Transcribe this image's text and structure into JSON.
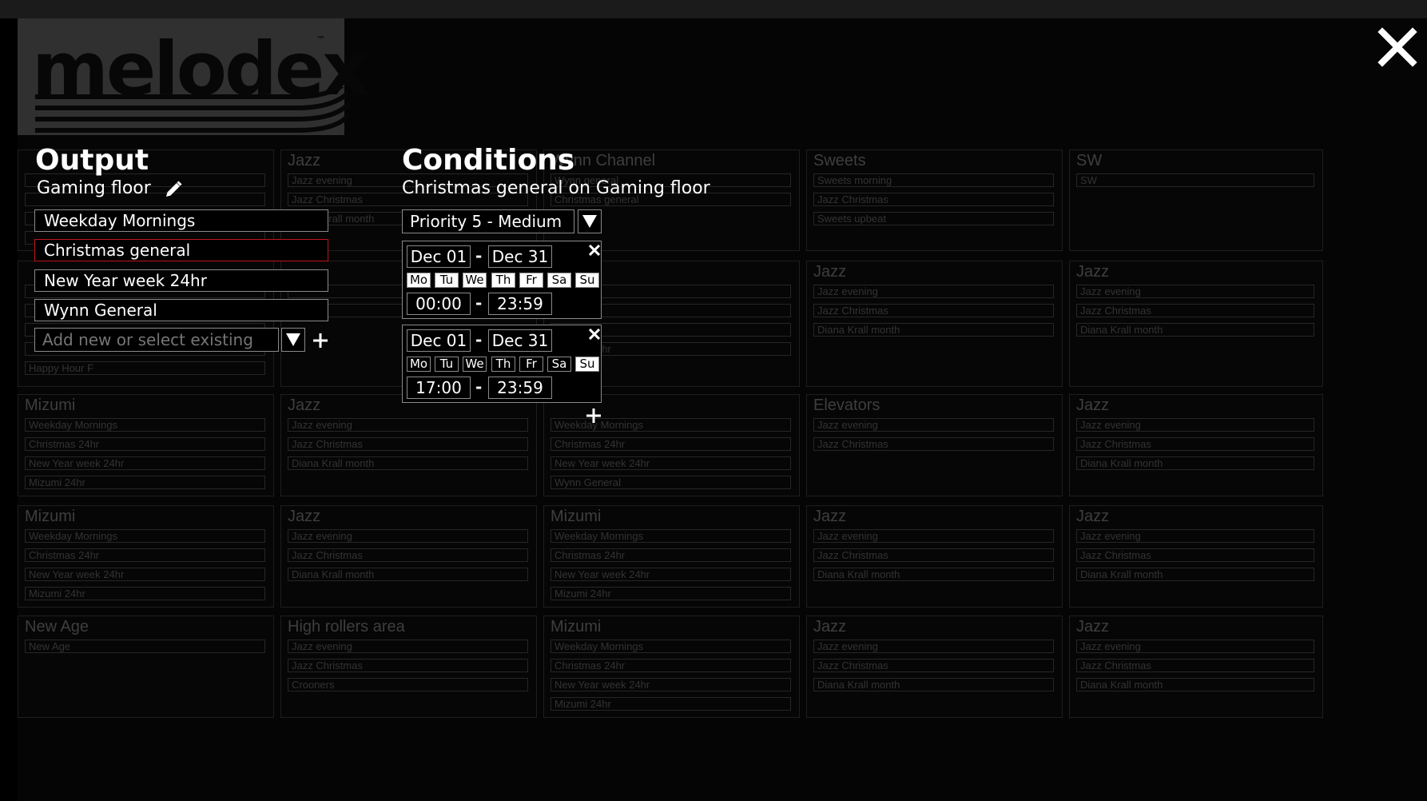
{
  "app": {
    "logo_text": "melodex",
    "logo_tm": "™",
    "close_icon": "close-icon"
  },
  "grid": [
    {
      "title": "",
      "items": [
        "",
        "",
        "",
        ""
      ]
    },
    {
      "title": "Jazz",
      "items": [
        "Jazz evening",
        "Jazz Christmas",
        "Diana Krall month"
      ]
    },
    {
      "title": "Wynn Channel",
      "items": [
        "Wynn general",
        "Christmas general"
      ]
    },
    {
      "title": "Sweets",
      "items": [
        "Sweets morning",
        "Jazz Christmas",
        "Sweets upbeat"
      ]
    },
    {
      "title": "SW",
      "items": [
        "SW"
      ]
    },
    {
      "title": "",
      "items": [
        "",
        "",
        "",
        "",
        "Happy Hour F"
      ]
    },
    {
      "title": "",
      "items": [
        "",
        ""
      ]
    },
    {
      "title": "",
      "items": [
        "",
        "",
        "",
        "Mizumi 24hr"
      ]
    },
    {
      "title": "Jazz",
      "items": [
        "Jazz evening",
        "Jazz Christmas",
        "Diana Krall month"
      ]
    },
    {
      "title": "Jazz",
      "items": [
        "Jazz evening",
        "Jazz Christmas",
        "Diana Krall month"
      ]
    },
    {
      "title": "Mizumi",
      "items": [
        "Weekday Mornings",
        "Christmas 24hr",
        "New Year week 24hr",
        "Mizumi 24hr"
      ]
    },
    {
      "title": "Jazz",
      "items": [
        "Jazz evening",
        "Jazz Christmas",
        "Diana Krall month"
      ]
    },
    {
      "title": "",
      "items": [
        "Weekday Mornings",
        "Christmas 24hr",
        "New Year week 24hr",
        "Wynn General"
      ]
    },
    {
      "title": "Elevators",
      "items": [
        "Jazz evening",
        "Jazz Christmas"
      ]
    },
    {
      "title": "Jazz",
      "items": [
        "Jazz evening",
        "Jazz Christmas",
        "Diana Krall month"
      ]
    },
    {
      "title": "Mizumi",
      "items": [
        "Weekday Mornings",
        "Christmas 24hr",
        "New Year week 24hr",
        "Mizumi 24hr"
      ]
    },
    {
      "title": "Jazz",
      "items": [
        "Jazz evening",
        "Jazz Christmas",
        "Diana Krall month"
      ]
    },
    {
      "title": "Mizumi",
      "items": [
        "Weekday Mornings",
        "Christmas 24hr",
        "New Year week 24hr",
        "Mizumi 24hr"
      ]
    },
    {
      "title": "Jazz",
      "items": [
        "Jazz evening",
        "Jazz Christmas",
        "Diana Krall month"
      ]
    },
    {
      "title": "Jazz",
      "items": [
        "Jazz evening",
        "Jazz Christmas",
        "Diana Krall month"
      ]
    },
    {
      "title": "New Age",
      "items": [
        "New Age"
      ]
    },
    {
      "title": "High rollers area",
      "items": [
        "Jazz evening",
        "Jazz Christmas",
        "Crooners"
      ]
    },
    {
      "title": "Mizumi",
      "items": [
        "Weekday Mornings",
        "Christmas 24hr",
        "New Year week 24hr",
        "Mizumi 24hr"
      ]
    },
    {
      "title": "Jazz",
      "items": [
        "Jazz evening",
        "Jazz Christmas",
        "Diana Krall month"
      ]
    },
    {
      "title": "Jazz",
      "items": [
        "Jazz evening",
        "Jazz Christmas",
        "Diana Krall month"
      ]
    }
  ],
  "output": {
    "heading": "Output",
    "name": "Gaming floor",
    "edit_icon": "pencil-icon",
    "items": [
      "Weekday Mornings",
      "Christmas general",
      "New Year week 24hr",
      "Wynn General"
    ],
    "selected_index": 1,
    "add_placeholder": "Add new or select existing"
  },
  "conditions": {
    "heading": "Conditions",
    "subtitle": "Christmas general on Gaming floor",
    "priority": "Priority 5 - Medium",
    "days": [
      "Mo",
      "Tu",
      "We",
      "Th",
      "Fr",
      "Sa",
      "Su"
    ],
    "blocks": [
      {
        "date_from": "Dec 01",
        "date_to": "Dec 31",
        "time_from": "00:00",
        "time_to": "23:59",
        "active_days": [
          0,
          1,
          2,
          3,
          4,
          5,
          6
        ]
      },
      {
        "date_from": "Dec 01",
        "date_to": "Dec 31",
        "time_from": "17:00",
        "time_to": "23:59",
        "active_days": [
          6
        ]
      }
    ],
    "separator": "-"
  }
}
